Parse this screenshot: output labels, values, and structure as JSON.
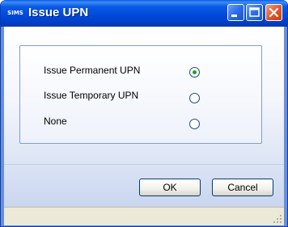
{
  "window": {
    "app_icon_text": "SIMS",
    "title": "Issue UPN"
  },
  "titlebar_buttons": {
    "minimize": "minimize-icon",
    "maximize": "maximize-icon",
    "close": "close-icon"
  },
  "options": [
    {
      "label": "Issue Permanent UPN",
      "selected": true
    },
    {
      "label": "Issue Temporary UPN",
      "selected": false
    },
    {
      "label": "None",
      "selected": false
    }
  ],
  "buttons": {
    "ok_label": "OK",
    "cancel_label": "Cancel"
  },
  "colors": {
    "titlebar": "#0048d8",
    "radio_selected": "#21a121"
  }
}
